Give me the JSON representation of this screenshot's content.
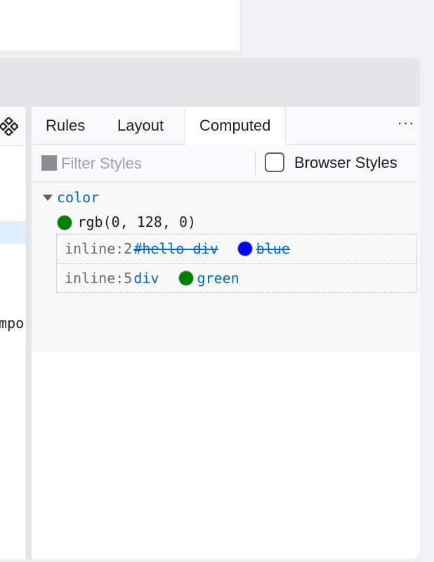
{
  "tabs": {
    "rules": "Rules",
    "layout": "Layout",
    "computed": "Computed",
    "more": "···"
  },
  "left_panel": {
    "partial_text": "mpor"
  },
  "filter": {
    "placeholder": "Filter Styles",
    "browser_styles_label": "Browser Styles",
    "browser_styles_checked": false
  },
  "computed": {
    "property_name": "color",
    "computed_value": "rgb(0, 128, 0)",
    "computed_swatch_color": "#008000",
    "matches": [
      {
        "source": "inline:2",
        "selector": "#hello div",
        "value": "blue",
        "swatch_color": "#0000ff",
        "overridden": true
      },
      {
        "source": "inline:5",
        "selector": "div",
        "value": "green",
        "swatch_color": "#008000",
        "overridden": false
      }
    ]
  },
  "colors": {
    "accent": "#0068c8",
    "selected_node": "#dceeff"
  }
}
